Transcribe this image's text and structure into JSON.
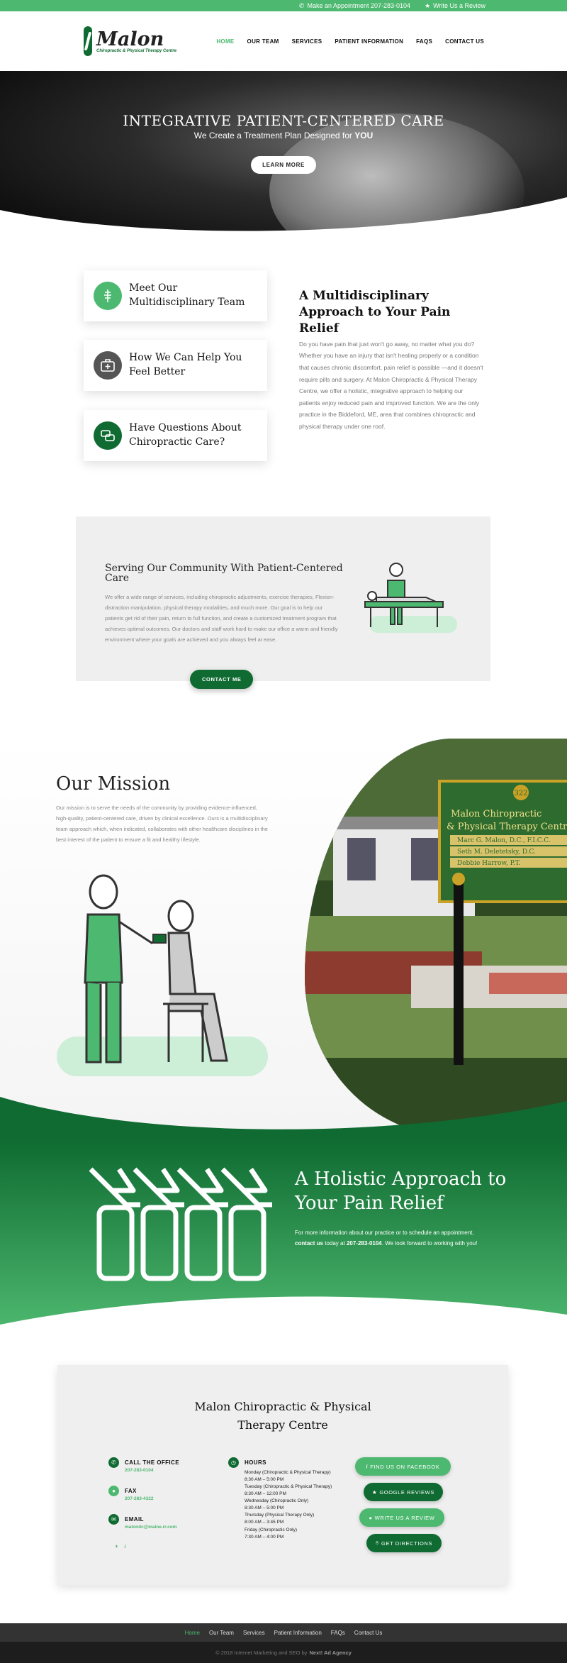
{
  "topbar": {
    "appointment": "Make an Appointment 207-283-0104",
    "review": "Write Us a Review"
  },
  "header": {
    "logo_name": "Malon",
    "logo_sub": "Chiropractic & Physical Therapy Centre",
    "nav": [
      "HOME",
      "OUR TEAM",
      "SERVICES",
      "PATIENT INFORMATION",
      "FAQS",
      "CONTACT US"
    ]
  },
  "hero": {
    "title": "INTEGRATIVE PATIENT-CENTERED CARE",
    "subtitle_prefix": "We Create a Treatment Plan Designed for ",
    "subtitle_emph": "YOU",
    "button": "LEARN MORE"
  },
  "services": {
    "cards": [
      {
        "title": "Meet Our Multidisciplinary Team",
        "icon": "spine-body-icon",
        "color": "#4db86f"
      },
      {
        "title": "How We Can Help You Feel Better",
        "icon": "first-aid-kit-icon",
        "color": "#555555"
      },
      {
        "title": "Have Questions About Chiropractic Care?",
        "icon": "chat-bubbles-icon",
        "color": "#0f6b31"
      }
    ],
    "heading": "A Multidisciplinary Approach to Your Pain Relief",
    "body": "Do you have pain that just won't go away, no matter what you do? Whether you have an injury that isn't healing properly or a condition that causes chronic discomfort, pain relief is possible —and it doesn't require pills and surgery. At Malon Chiropractic & Physical Therapy Centre, we offer a holistic, integrative approach to helping our patients enjoy reduced pain and improved function. We are the only practice in the Biddeford, ME, area that combines chiropractic and physical therapy under one roof."
  },
  "community": {
    "heading": "Serving Our Community With Patient-Centered Care",
    "body": "We offer a wide range of services, including chiropractic adjustments, exercise therapies, Flexion-distraction manipulation, physical therapy modalities, and much more. Our goal is to help our patients get rid of their pain, return to full function, and create a customized treatment program that achieves optimal outcomes. Our doctors and staff work hard to make our office a warm and friendly environment where your goals are achieved and you always feel at ease.",
    "button": "CONTACT ME"
  },
  "mission": {
    "heading": "Our Mission",
    "body": "Our mission is to serve the needs of the community by providing evidence-influenced, high-quality, patient-centered care, driven by clinical excellence. Ours is a multidisciplinary team approach which, when indicated, collaborates with other healthcare disciplines in the best interest of the patient to ensure a fit and healthy lifestyle.",
    "sign_number": "322",
    "sign_title": "Malon Chiropractic & Physical Therapy Centre",
    "sign_lines": [
      "Marc G. Malon, D.C., F.I.C.C.",
      "Seth M. Deletetsky, D.C.",
      "Debbie Harrow, P.T."
    ]
  },
  "holistic": {
    "heading": "A Holistic Approach to Your Pain Relief",
    "body_prefix": "For more information about our practice or to schedule an appointment, ",
    "body_link": "contact us",
    "body_mid": " today at ",
    "body_phone": "207-283-0104",
    "body_suffix": ". We look forward to working with you!"
  },
  "contact": {
    "heading": "Malon Chiropractic & Physical Therapy Centre",
    "call_label": "CALL THE OFFICE",
    "call_value": "207-283-0104",
    "fax_label": "FAX",
    "fax_value": "207-283-4322",
    "email_label": "EMAIL",
    "email_value": "malondc@maine.rr.com",
    "hours_label": "HOURS",
    "hours": [
      "Monday (Chiropractic & Physical Therapy)",
      "8:30 AM – 5:00 PM",
      "Tuesday (Chiropractic & Physical Therapy)",
      "8:30 AM – 12:00 PM",
      "Wednesday (Chiropractic Only)",
      "8:30 AM – 5:00 PM",
      "Thursday (Physical Therapy Only)",
      "8:00 AM – 3:45 PM",
      "Friday (Chiropractic Only)",
      "7:30 AM – 4:00 PM"
    ],
    "buttons": {
      "facebook": "FIND US ON FACEBOOK",
      "google": "GOOGLE REVIEWS",
      "review": "WRITE US A REVIEW",
      "directions": "GET DIRECTIONS"
    }
  },
  "footer": {
    "nav": [
      "Home",
      "Our Team",
      "Services",
      "Patient Information",
      "FAQs",
      "Contact Us"
    ],
    "copy_prefix": "© 2018 Internet Marketing and SEO by",
    "copy_brand": "Next! Ad Agency"
  },
  "colors": {
    "accent": "#4db86f",
    "brand_dark": "#0f6b31"
  }
}
